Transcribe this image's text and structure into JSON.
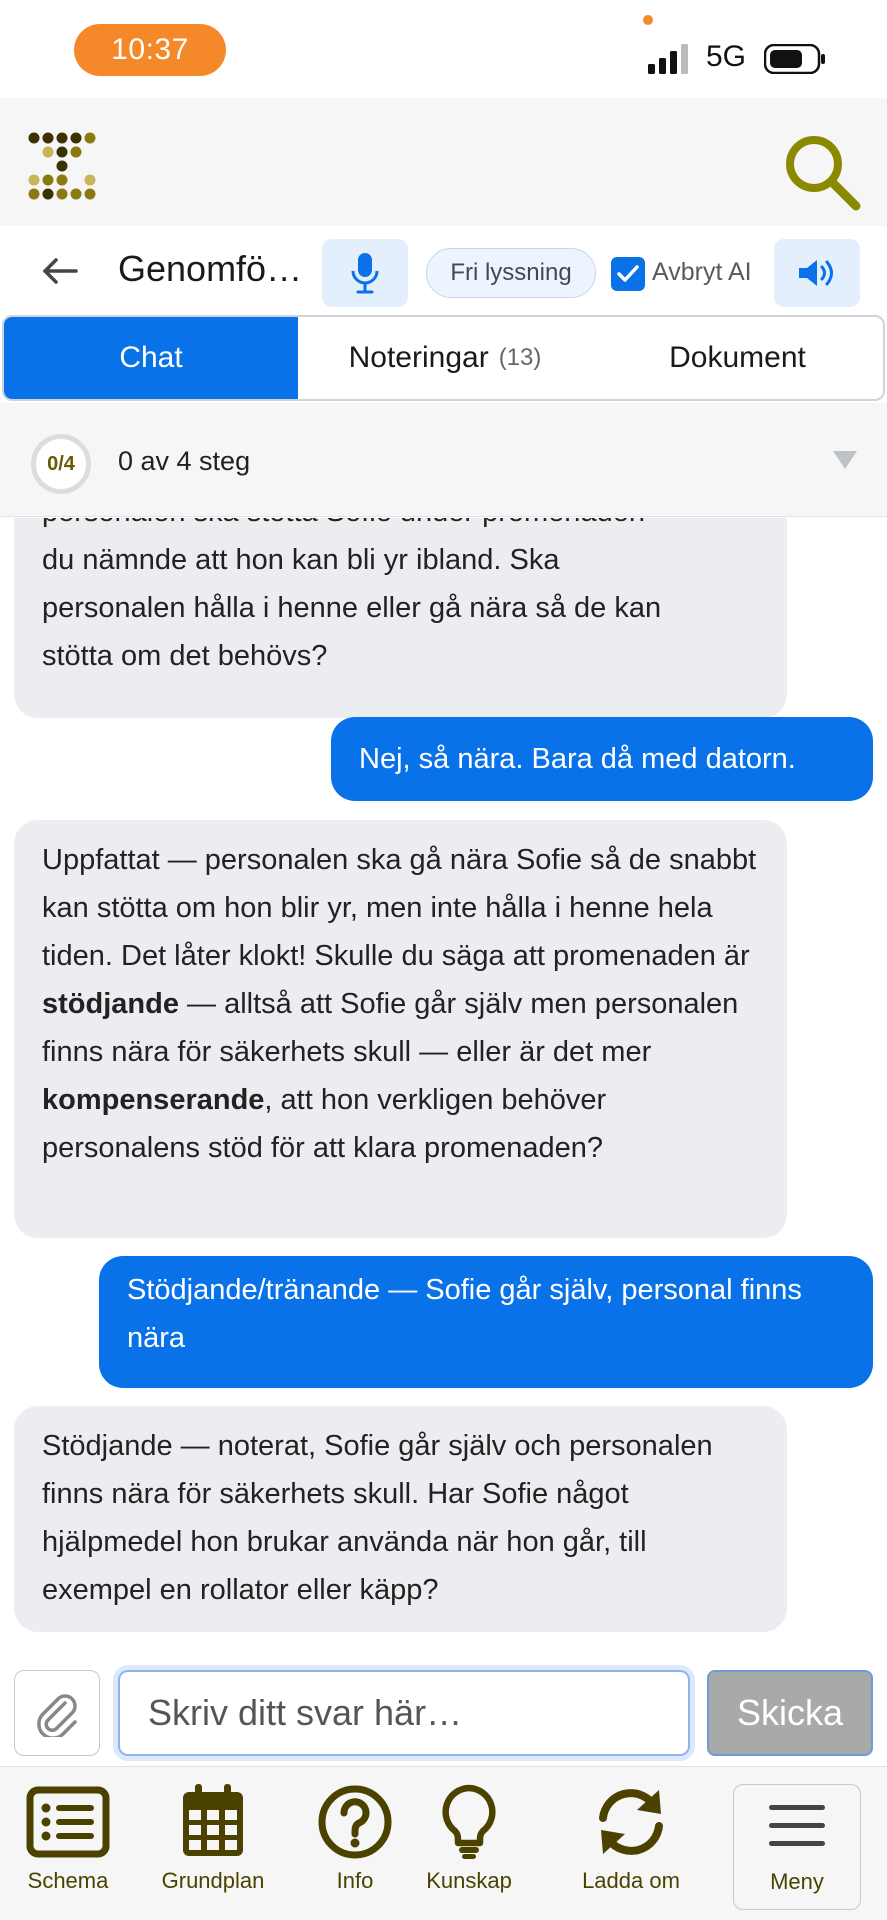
{
  "status_bar": {
    "time": "10:37",
    "network": "5G"
  },
  "toolbar": {
    "title": "Genomfö…",
    "fri_lyssning_label": "Fri lyssning",
    "avbryt_ai_label": "Avbryt AI",
    "avbryt_ai_checked": true
  },
  "tabs": [
    {
      "label": "Chat",
      "active": true
    },
    {
      "label": "Noteringar",
      "count": "(13)",
      "active": false
    },
    {
      "label": "Dokument",
      "active": false
    }
  ],
  "steps": {
    "badge": "0/4",
    "text": "0 av 4 steg",
    "completed": 0,
    "total": 4
  },
  "messages": [
    {
      "role": "assistant",
      "lines": [
        "personalen ska stötta Sofie under promenaden",
        "du nämnde att hon kan bli yr ibland. Ska",
        "personalen hålla i henne eller gå nära så de kan",
        "stötta om det behövs?"
      ]
    },
    {
      "role": "user",
      "text": "Nej, så nära. Bara då med datorn."
    },
    {
      "role": "assistant",
      "p1": "Uppfattat — personalen ska gå nära Sofie så de snabbt kan stötta om hon blir yr, men inte hålla i henne hela tiden. Det låter klokt! Skulle du säga att promenaden är ",
      "b1": "stödjande",
      "p2": " — alltså att Sofie går själv men personalen finns nära för säkerhets skull — eller är det mer ",
      "b2": "kompenserande",
      "p3": ", att hon verkligen behöver personalens stöd för att klara promenaden?"
    },
    {
      "role": "user",
      "text": "Stödjande/tränande — Sofie går själv, personal finns nära"
    },
    {
      "role": "assistant",
      "text": "Stödjande — noterat, Sofie går själv och personalen finns nära för säkerhets skull. Har Sofie något hjälpmedel hon brukar använda när hon går, till exempel en rollator eller käpp?"
    }
  ],
  "composer": {
    "placeholder": "Skriv ditt svar här…",
    "send_label": "Skicka"
  },
  "bottom_nav": [
    {
      "label": "Schema",
      "icon": "list-icon"
    },
    {
      "label": "Grundplan",
      "icon": "calendar-icon"
    },
    {
      "label": "Info",
      "icon": "question-icon"
    },
    {
      "label": "Kunskap",
      "icon": "lightbulb-icon"
    },
    {
      "label": "Ladda om",
      "icon": "refresh-icon"
    },
    {
      "label": "Meny",
      "icon": "hamburger-icon"
    }
  ],
  "colors": {
    "accent_blue": "#0a72e8",
    "brand_olive": "#8a8a00",
    "nav_icon": "#4b4200",
    "time_pill": "#f5892a"
  }
}
